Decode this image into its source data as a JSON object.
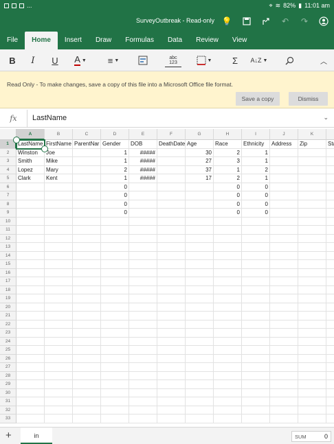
{
  "status": {
    "battery": "82%",
    "time": "11:01 am",
    "dots": "..."
  },
  "titlebar": {
    "title": "SurveyOutbreak - Read-only"
  },
  "tabs": [
    {
      "label": "File",
      "active": false
    },
    {
      "label": "Home",
      "active": true
    },
    {
      "label": "Insert",
      "active": false
    },
    {
      "label": "Draw",
      "active": false
    },
    {
      "label": "Formulas",
      "active": false
    },
    {
      "label": "Data",
      "active": false
    },
    {
      "label": "Review",
      "active": false
    },
    {
      "label": "View",
      "active": false
    }
  ],
  "toolbar": {
    "bold": "B",
    "italic": "I",
    "underline": "U",
    "font_color": "A",
    "number_format": "abc\n123",
    "sum": "Σ",
    "sort": "A↓Z"
  },
  "banner": {
    "message": "Read Only - To make changes, save a copy of this file into a Microsoft Office file format.",
    "save_copy": "Save a copy",
    "dismiss": "Dismiss"
  },
  "formula_bar": {
    "fx": "fx",
    "value": "LastName"
  },
  "grid": {
    "columns": [
      "A",
      "B",
      "C",
      "D",
      "E",
      "F",
      "G",
      "H",
      "I",
      "J",
      "K"
    ],
    "rows": [
      [
        "LastName",
        "FirstName",
        "ParentNar",
        "Gender",
        "DOB",
        "DeathDate",
        "Age",
        "Race",
        "Ethnicity",
        "Address",
        "Zip",
        "Stat"
      ],
      [
        "Winston",
        "Joe",
        "",
        "1",
        "#####",
        "",
        "30",
        "2",
        "1",
        "",
        "",
        ""
      ],
      [
        "Smith",
        "Mike",
        "",
        "1",
        "#####",
        "",
        "27",
        "3",
        "1",
        "",
        "",
        ""
      ],
      [
        "Lopez",
        "Mary",
        "",
        "2",
        "#####",
        "",
        "37",
        "1",
        "2",
        "",
        "",
        ""
      ],
      [
        "Clark",
        "Kent",
        "",
        "1",
        "#####",
        "",
        "17",
        "2",
        "1",
        "",
        "",
        ""
      ],
      [
        "",
        "",
        "",
        "0",
        "",
        "",
        "",
        "0",
        "0",
        "",
        "",
        ""
      ],
      [
        "",
        "",
        "",
        "0",
        "",
        "",
        "",
        "0",
        "0",
        "",
        "",
        ""
      ],
      [
        "",
        "",
        "",
        "0",
        "",
        "",
        "",
        "0",
        "0",
        "",
        "",
        ""
      ],
      [
        "",
        "",
        "",
        "0",
        "",
        "",
        "",
        "0",
        "0",
        "",
        "",
        ""
      ]
    ],
    "row_count": 33,
    "selected_cell": "A1"
  },
  "sheetbar": {
    "add": "+",
    "sheet_name": "in",
    "sum_label": "SUM",
    "sum_value": "0"
  }
}
